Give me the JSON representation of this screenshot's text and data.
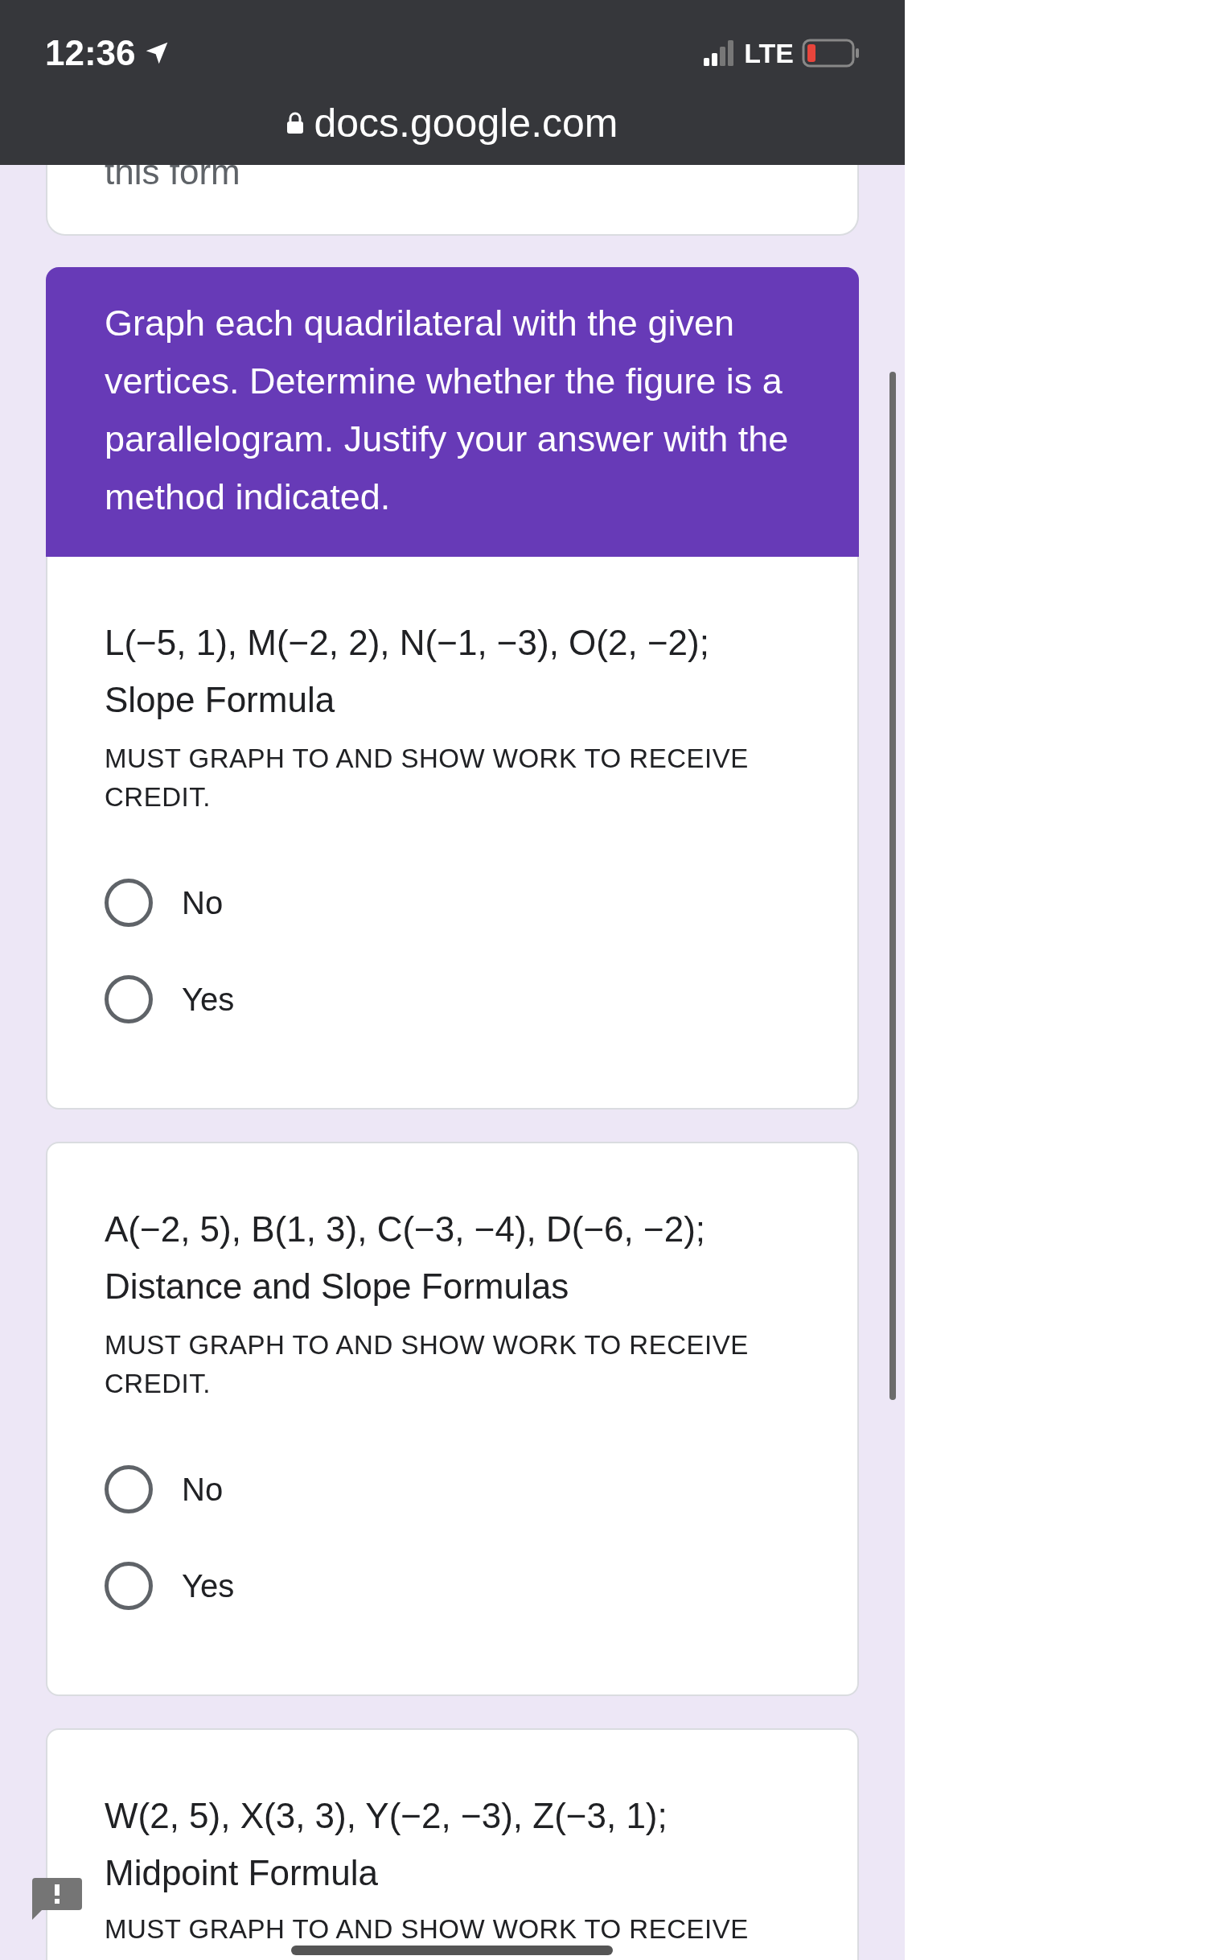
{
  "status_bar": {
    "time": "12:36",
    "network": "LTE"
  },
  "address_bar": {
    "url": "docs.google.com"
  },
  "partial_card": {
    "text": "this form"
  },
  "section": {
    "text": "Graph each quadrilateral with the given vertices. Determine whether the figure is a parallelogram. Justify your answer with the method indicated."
  },
  "questions": [
    {
      "points": "L(−5, 1), M(−2, 2), N(−1, −3), O(2, −2);",
      "method": "Slope Formula",
      "note": "MUST GRAPH TO AND SHOW WORK TO RECEIVE CREDIT.",
      "options": [
        {
          "label": "No",
          "selected": false
        },
        {
          "label": "Yes",
          "selected": false
        }
      ]
    },
    {
      "points": "A(−2, 5), B(1, 3), C(−3, −4), D(−6, −2);",
      "method": "Distance and Slope Formulas",
      "note": "MUST GRAPH TO AND SHOW WORK TO RECEIVE CREDIT.",
      "options": [
        {
          "label": "No",
          "selected": false
        },
        {
          "label": "Yes",
          "selected": false
        }
      ]
    },
    {
      "points": "W(2, 5), X(3, 3), Y(−2, −3), Z(−3, 1);",
      "method": "Midpoint Formula",
      "note": "MUST GRAPH TO AND SHOW WORK TO RECEIVE"
    }
  ]
}
